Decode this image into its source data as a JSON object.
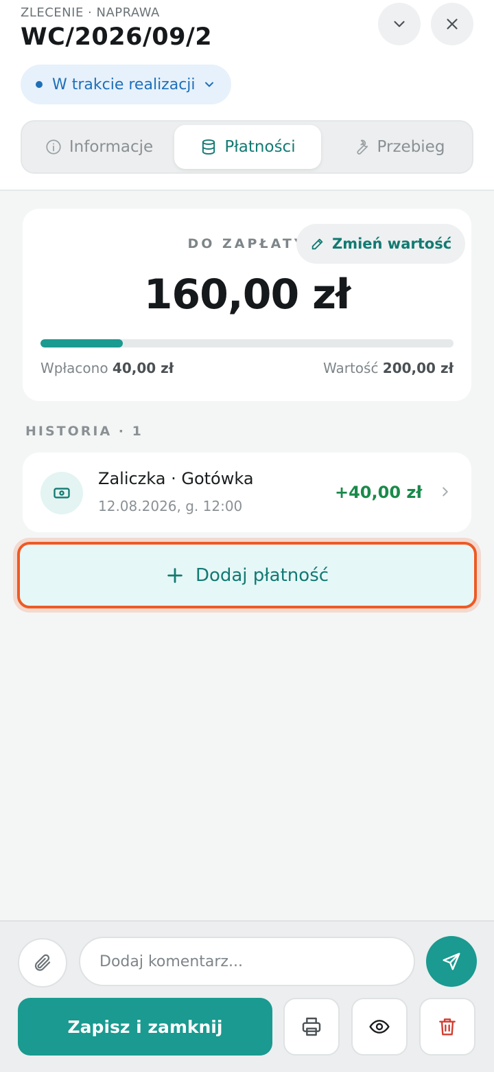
{
  "header": {
    "eyebrow": "ZLECENIE · NAPRAWA",
    "order_number": "WC/2026/09/2",
    "collapse_icon": "chevron-down-icon",
    "close_icon": "close-icon"
  },
  "status": {
    "label": "W trakcie realizacji",
    "color": "#1f6fb8"
  },
  "tabs": [
    {
      "label": "Informacje",
      "icon": "info-icon",
      "active": false
    },
    {
      "label": "Płatności",
      "icon": "database-icon",
      "active": true
    },
    {
      "label": "Przebieg",
      "icon": "wrench-icon",
      "active": false
    }
  ],
  "payment": {
    "due_label": "DO ZAPŁATY",
    "edit_label": "Zmień wartość",
    "due_amount": "160,00 zł",
    "paid_label": "Wpłacono",
    "paid_amount": "40,00 zł",
    "value_label": "Wartość",
    "value_amount": "200,00 zł",
    "progress_fraction": 0.2,
    "accent_color": "#1a9a90"
  },
  "history": {
    "label": "HISTORIA · 1",
    "items": [
      {
        "title": "Zaliczka · Gotówka",
        "date": "12.08.2026, g. 12:00",
        "amount": "+40,00 zł",
        "icon": "cash-icon"
      }
    ]
  },
  "add_payment": {
    "label": "Dodaj płatność",
    "highlight_color": "#ee5a24"
  },
  "footer": {
    "comment_placeholder": "Dodaj komentarz...",
    "save_label": "Zapisz i zamknij",
    "attach_icon": "paperclip-icon",
    "send_icon": "send-icon",
    "print_icon": "printer-icon",
    "preview_icon": "eye-icon",
    "delete_icon": "trash-icon"
  }
}
